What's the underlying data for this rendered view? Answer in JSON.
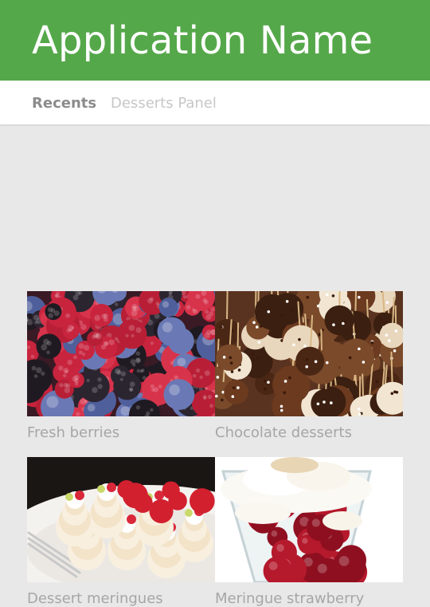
{
  "app": {
    "title": "Application Name",
    "accent": "#55a84a"
  },
  "tabs": [
    {
      "label": "Recents",
      "active": true
    },
    {
      "label": "Desserts Panel",
      "active": false
    }
  ],
  "tiles": [
    {
      "caption": "Fresh berries",
      "image": "berries-photo"
    },
    {
      "caption": "Chocolate desserts",
      "image": "chocolate-desserts-photo"
    },
    {
      "caption": "Dessert meringues",
      "image": "meringues-photo"
    },
    {
      "caption": "Meringue strawberry",
      "image": "meringue-strawberry-photo"
    }
  ]
}
